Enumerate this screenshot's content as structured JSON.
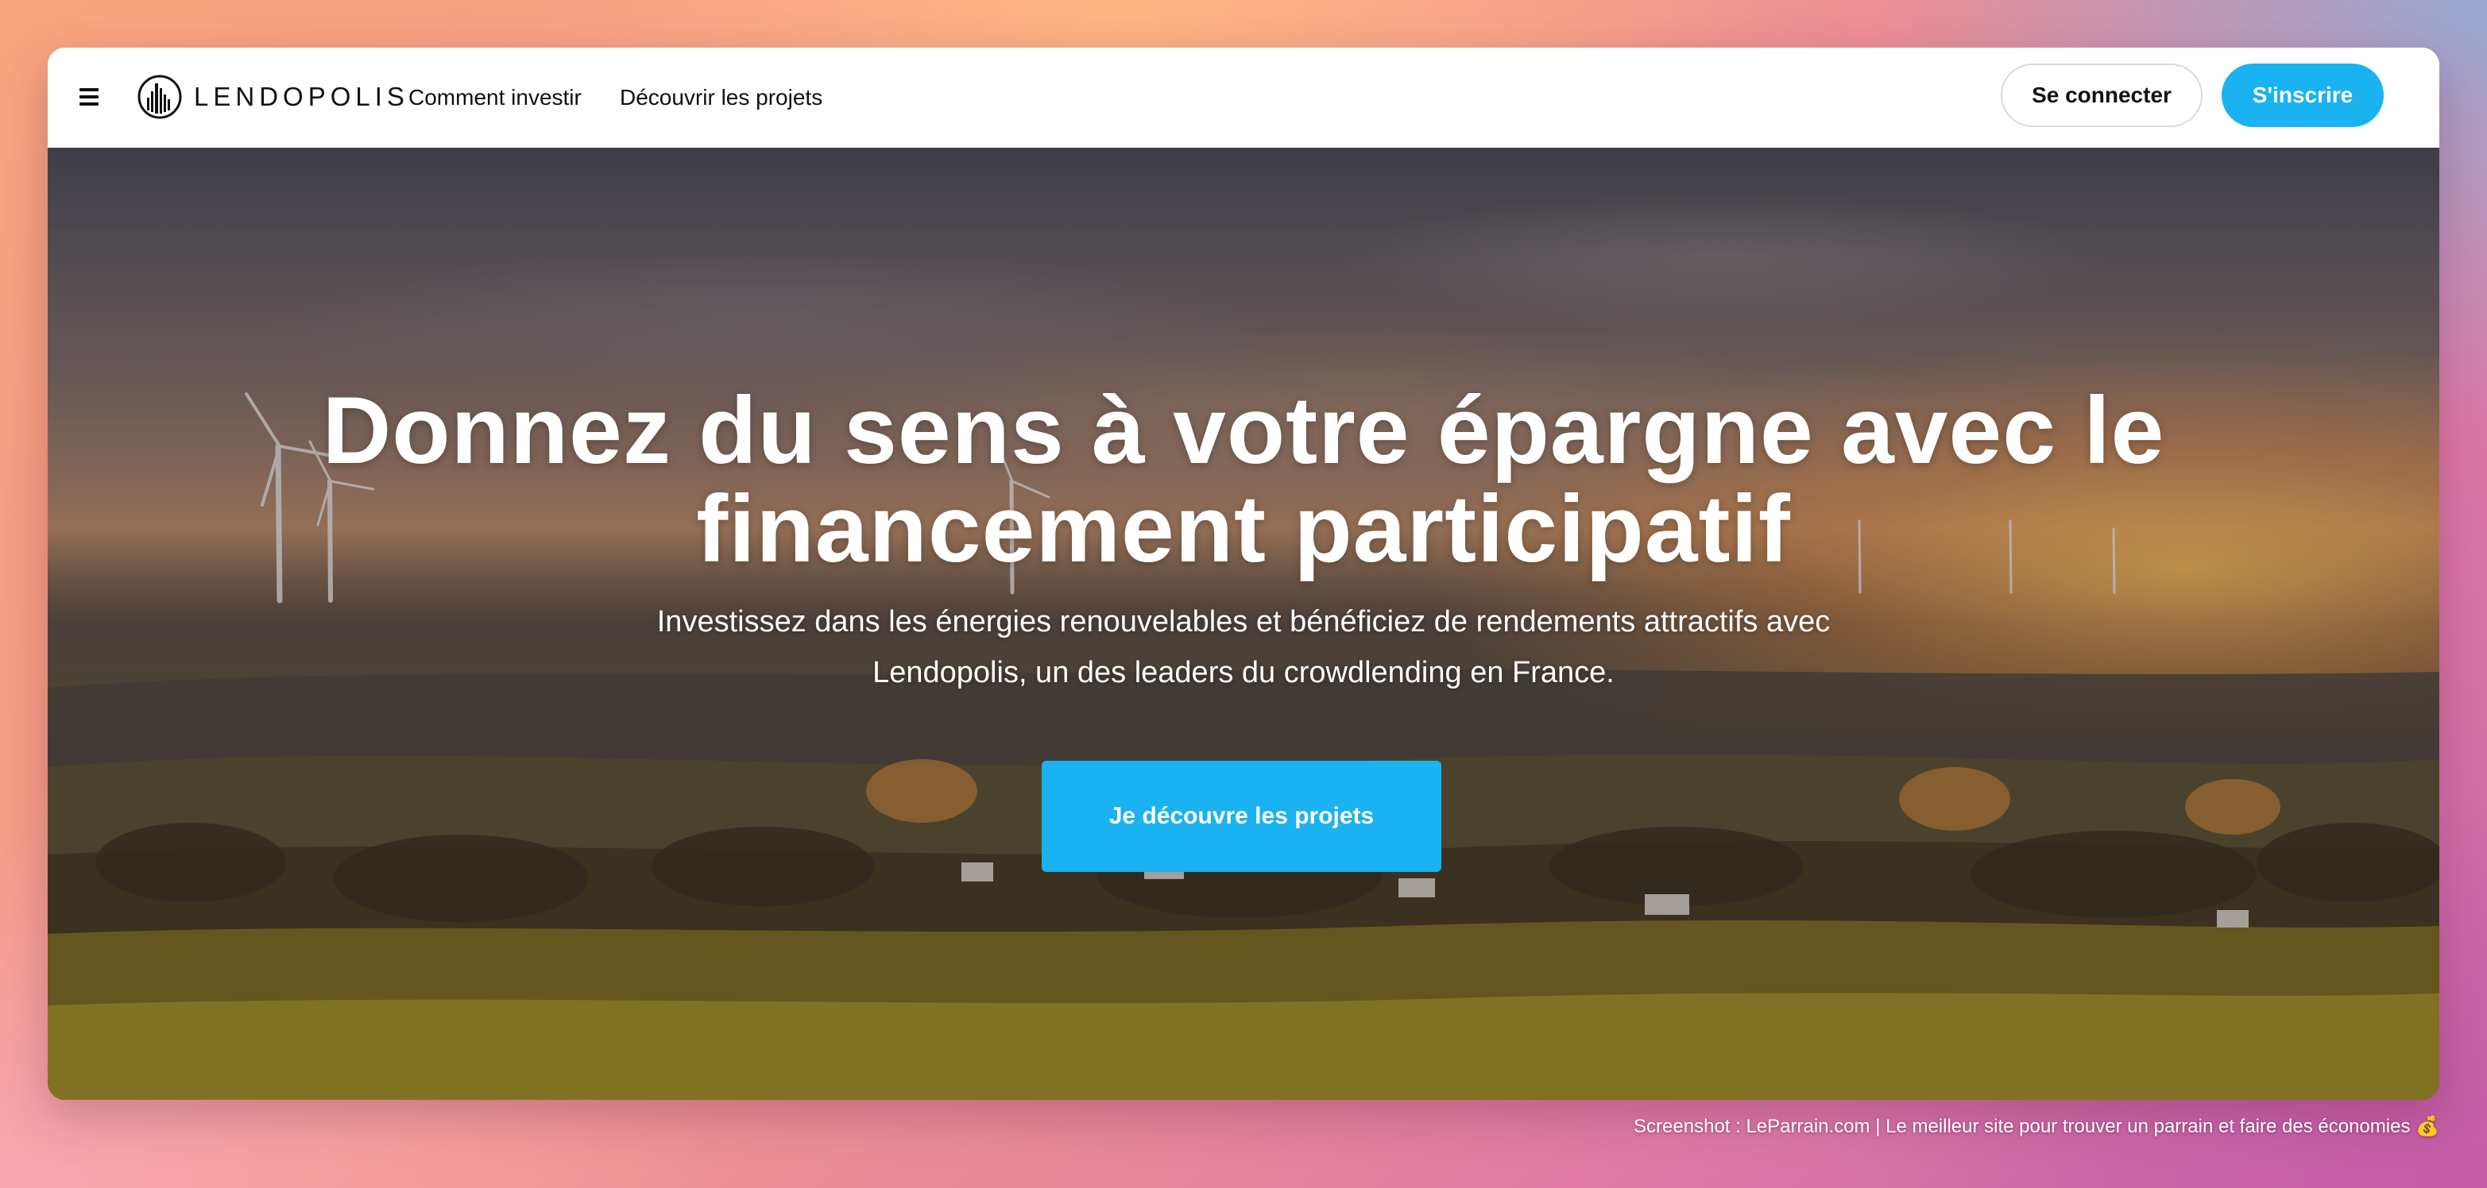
{
  "nav": {
    "brand": "LENDOPOLIS",
    "links": [
      "Comment investir",
      "Découvrir les projets"
    ],
    "login_label": "Se connecter",
    "signup_label": "S'inscrire"
  },
  "hero": {
    "title_line1": "Donnez du sens à votre épargne avec le",
    "title_line2": "financement participatif",
    "subtitle_line1": "Investissez dans les énergies renouvelables et bénéficiez de rendements attractifs avec",
    "subtitle_line2": "Lendopolis, un des leaders du crowdlending en France.",
    "cta_label": "Je découvre les projets"
  },
  "footer_credit": "Screenshot : LeParrain.com | Le meilleur site pour trouver un parrain et faire des économies 💰",
  "colors": {
    "accent": "#1ab2f0",
    "nav_bg": "#ffffff",
    "text_dark": "#111111"
  },
  "icons": {
    "menu": "hamburger-menu-icon",
    "logo": "lendopolis-logo-mark"
  }
}
